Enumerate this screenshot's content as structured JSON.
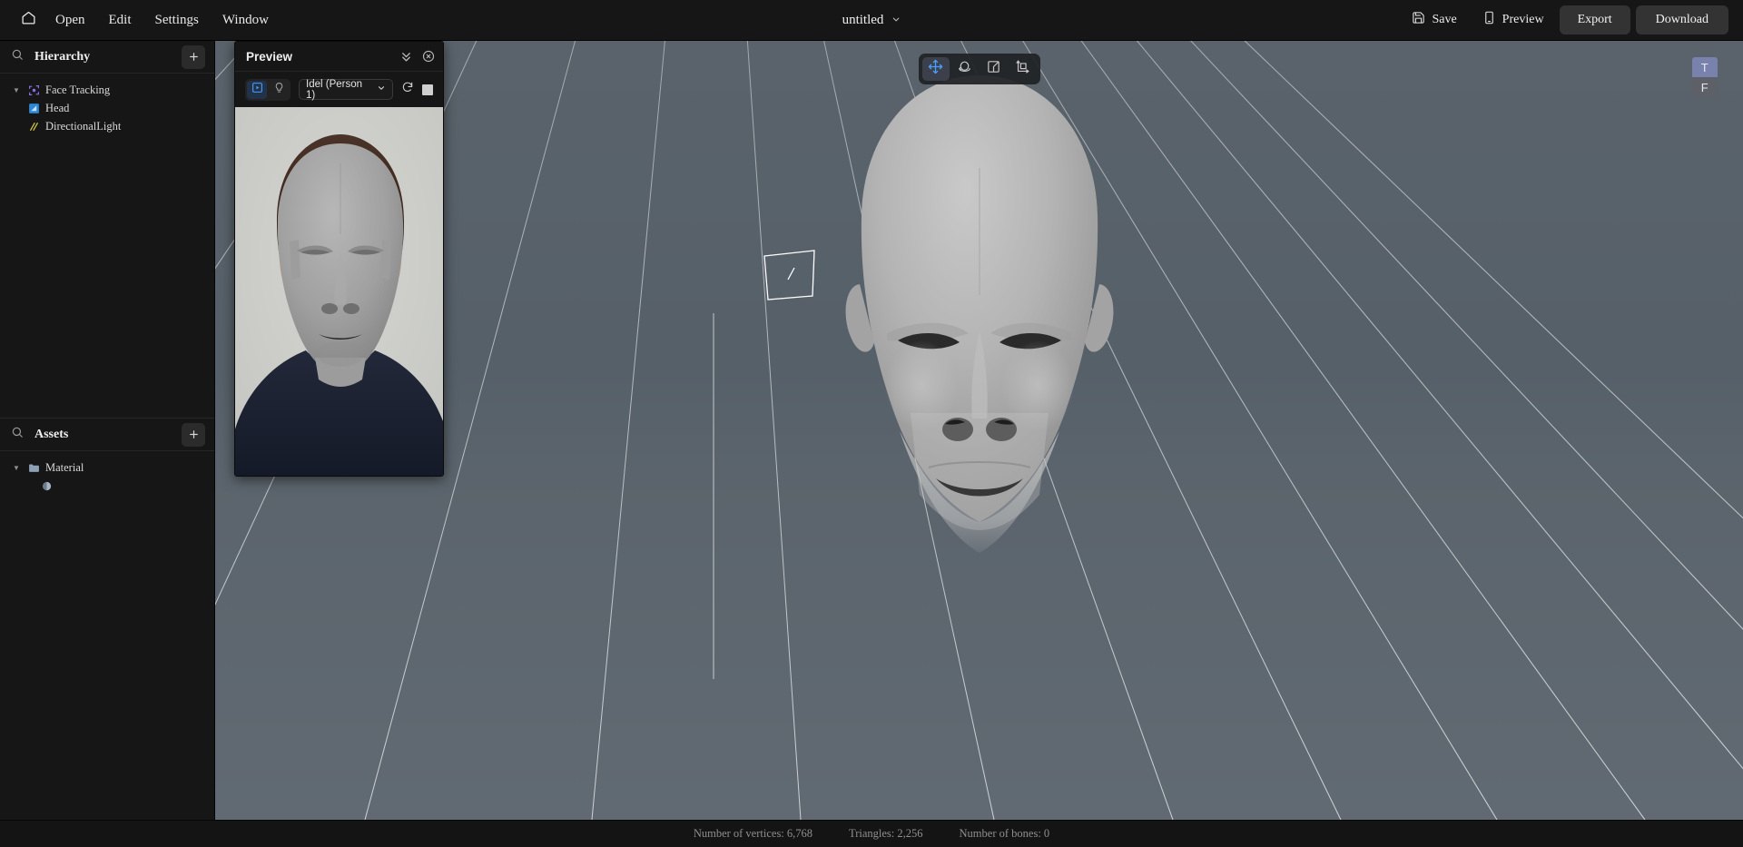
{
  "topbar": {
    "home_icon": "home-icon",
    "menus": [
      {
        "label": "Open"
      },
      {
        "label": "Edit"
      },
      {
        "label": "Settings"
      },
      {
        "label": "Window"
      }
    ],
    "document_title": "untitled",
    "title_chevron_icon": "chevron-down-icon",
    "actions": [
      {
        "label": "Save",
        "icon": "save-floppy-icon"
      },
      {
        "label": "Preview",
        "icon": "mobile-phone-icon"
      }
    ],
    "export_label": "Export",
    "download_label": "Download"
  },
  "hierarchy": {
    "title": "Hierarchy",
    "search_icon": "search-icon",
    "add_icon": "plus-icon",
    "nodes": [
      {
        "label": "Face Tracking",
        "icon": "face-tracking-icon",
        "depth": 1,
        "expanded": true
      },
      {
        "label": "Head",
        "icon": "mesh-icon",
        "depth": 2
      },
      {
        "label": "DirectionalLight",
        "icon": "directional-light-icon",
        "depth": 2
      }
    ]
  },
  "assets": {
    "title": "Assets",
    "search_icon": "search-icon",
    "add_icon": "plus-icon",
    "nodes": [
      {
        "label": "Material",
        "icon": "folder-icon",
        "depth": 1,
        "expanded": true
      },
      {
        "label": "",
        "icon": "material-sphere-icon",
        "depth": 3
      }
    ]
  },
  "preview_panel": {
    "title": "Preview",
    "collapse_icon": "chevrons-down-icon",
    "close_icon": "close-circle-icon",
    "mode_buttons": [
      {
        "icon": "play-box-icon",
        "active": true
      },
      {
        "icon": "lightbulb-icon",
        "active": false
      }
    ],
    "animation_select": {
      "value": "Idel (Person 1)",
      "chevron_icon": "chevron-down-icon"
    },
    "refresh_icon": "refresh-icon",
    "stop_icon": "stop-square-icon"
  },
  "viewport": {
    "tools": [
      {
        "name": "move-tool",
        "icon": "move-arrows-icon",
        "active": true
      },
      {
        "name": "rotate-tool",
        "icon": "rotate-icon",
        "active": false
      },
      {
        "name": "scale-tool",
        "icon": "scale-icon",
        "active": false
      },
      {
        "name": "transform-tool",
        "icon": "transform-axis-icon",
        "active": false
      }
    ],
    "axis_gizmo": [
      {
        "label": "T",
        "selected": true
      },
      {
        "label": "F",
        "selected": false
      }
    ]
  },
  "statusbar": {
    "items": [
      {
        "text": "Number of vertices: 6,768"
      },
      {
        "text": "Triangles: 2,256"
      },
      {
        "text": "Number of bones: 0"
      }
    ]
  },
  "colors": {
    "accent_blue": "#4a9eff",
    "viewport_bg": "#566069",
    "panel_bg": "#161616",
    "button_bg": "#333333",
    "gizmo_selected": "#7981ad"
  }
}
